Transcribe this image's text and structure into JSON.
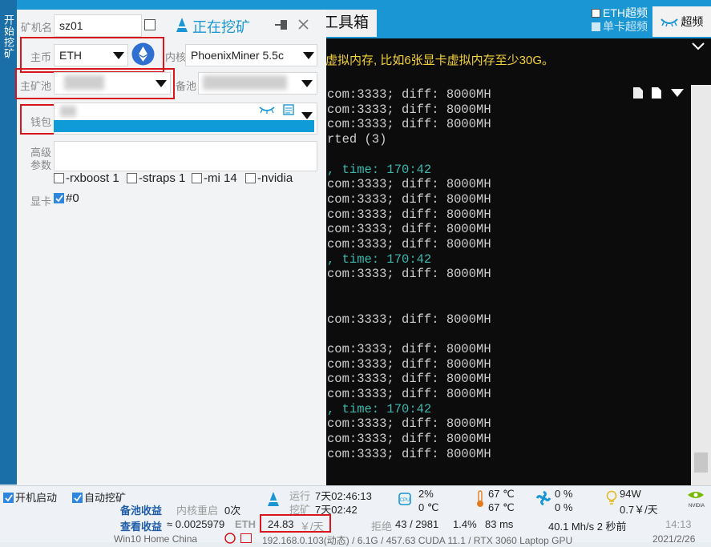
{
  "topbar": {
    "toolbox_tab": "工具箱",
    "oc_eth_label": "ETH超频",
    "oc_single_label": "单卡超频",
    "oc_button": "超频"
  },
  "sidebar": {
    "label": "开始挖矿"
  },
  "panel": {
    "miner_name_label": "矿机名",
    "miner_name_value": "sz01",
    "status_title": "正在挖矿",
    "coin_label": "主币",
    "coin_value": "ETH",
    "kernel_label": "内核",
    "kernel_value": "PhoenixMiner 5.5c",
    "main_pool_label": "主矿池",
    "backup_pool_label": "备池",
    "wallet_label": "钱包",
    "advanced_label_1": "高级",
    "advanced_label_2": "参数",
    "options": [
      {
        "label": "-rxboost 1",
        "checked": false
      },
      {
        "label": "-straps 1",
        "checked": false
      },
      {
        "label": "-mi 14",
        "checked": false
      },
      {
        "label": "-nvidia",
        "checked": false
      }
    ],
    "gpu_label": "显卡",
    "gpu_item": "#0",
    "gpu_checked": true
  },
  "terminal": {
    "notice": "虚拟内存, 比如6张显卡虚拟内存至少30G。",
    "lines": [
      {
        "text": "com:3333; diff: 8000MH",
        "color": "grey"
      },
      {
        "text": "com:3333; diff: 8000MH",
        "color": "grey"
      },
      {
        "text": "com:3333; diff: 8000MH",
        "color": "grey"
      },
      {
        "text": "rted (3)",
        "color": "grey"
      },
      {
        "text": "",
        "color": "grey"
      },
      {
        "text": ", time: 170:42",
        "color": "cyan"
      },
      {
        "text": "com:3333; diff: 8000MH",
        "color": "grey"
      },
      {
        "text": "com:3333; diff: 8000MH",
        "color": "grey"
      },
      {
        "text": "com:3333; diff: 8000MH",
        "color": "grey"
      },
      {
        "text": "com:3333; diff: 8000MH",
        "color": "grey"
      },
      {
        "text": "com:3333; diff: 8000MH",
        "color": "grey"
      },
      {
        "text": ", time: 170:42",
        "color": "cyan"
      },
      {
        "text": "com:3333; diff: 8000MH",
        "color": "grey"
      },
      {
        "text": "",
        "color": "grey"
      },
      {
        "text": "",
        "color": "grey"
      },
      {
        "text": "com:3333; diff: 8000MH",
        "color": "grey"
      },
      {
        "text": "",
        "color": "grey"
      },
      {
        "text": "com:3333; diff: 8000MH",
        "color": "grey"
      },
      {
        "text": "com:3333; diff: 8000MH",
        "color": "grey"
      },
      {
        "text": "com:3333; diff: 8000MH",
        "color": "grey"
      },
      {
        "text": "com:3333; diff: 8000MH",
        "color": "grey"
      },
      {
        "text": ", time: 170:42",
        "color": "cyan"
      },
      {
        "text": "com:3333; diff: 8000MH",
        "color": "grey"
      },
      {
        "text": "com:3333; diff: 8000MH",
        "color": "grey"
      },
      {
        "text": "com:3333; diff: 8000MH",
        "color": "grey"
      }
    ]
  },
  "statusbar": {
    "autostart_label": "开机启动",
    "automine_label": "自动挖矿",
    "backup_income_label": "备池收益",
    "kernel_restart_label": "内核重启",
    "kernel_restart_value": "0次",
    "view_income_label": "查看收益",
    "income_eth": "≈ 0.0025979",
    "income_unit": "ETH",
    "income_cny": "24.83",
    "income_cny_unit": "￥/天",
    "run_label": "运行",
    "run_value": "7天02:46:13",
    "mine_label": "挖矿",
    "mine_value": "7天02:42",
    "reject_label": "拒绝",
    "reject_value": "43 / 2981",
    "reject_pct": "1.4%",
    "latency": "83 ms",
    "cpu_usage": "2%",
    "cpu_temp": "0 ℃",
    "gpu_temp_1": "67 ℃",
    "gpu_temp_2": "67 ℃",
    "fan_1": "0 %",
    "fan_2": "0 %",
    "power": "94W",
    "power_cost": "0.7￥/天",
    "hashrate": "40.1 Mh/s 2 秒前",
    "clock_time": "14:13",
    "clock_date": "2021/2/26",
    "sys_info": "Win10 Home China",
    "net_info": "192.168.0.103(动态) / 6.1G / 457.63 CUDA 11.1 / RTX 3060 Laptop GPU"
  }
}
